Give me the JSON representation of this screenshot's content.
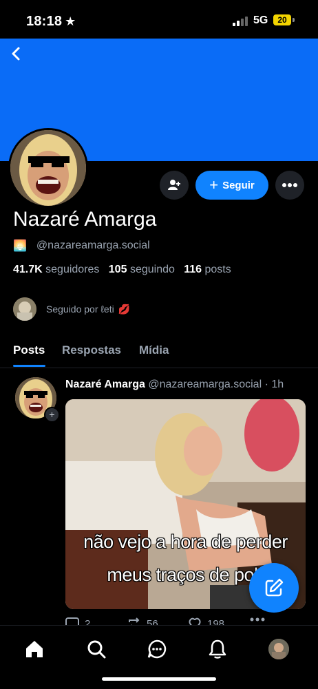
{
  "status_bar": {
    "time": "18:18",
    "star": "★",
    "network": "5G",
    "battery": "20"
  },
  "profile": {
    "name": "Nazaré Amarga",
    "handle_emoji": "🌅",
    "handle": "@nazareamarga.social",
    "followers_count": "41.7K",
    "followers_label": "seguidores",
    "following_count": "105",
    "following_label": "seguindo",
    "posts_count": "116",
    "posts_label": "posts",
    "followed_by": "Seguido por ℓeti",
    "followed_by_emoji": "💋",
    "banner_color": "#0a6cf7"
  },
  "actions": {
    "follow_label": "Seguir",
    "follow_icon": "plus-icon",
    "accent": "#1083fe"
  },
  "tabs": [
    {
      "label": "Posts",
      "active": true
    },
    {
      "label": "Respostas",
      "active": false
    },
    {
      "label": "Mídia",
      "active": false
    }
  ],
  "post": {
    "author": "Nazaré Amarga",
    "handle": "@nazareamarga.social",
    "separator": "·",
    "time": "1h",
    "caption_line1": "não vejo a hora de perder",
    "caption_line2": "meus traços de pob",
    "replies": "2",
    "reposts": "56",
    "likes": "198"
  },
  "nav": [
    "home-icon",
    "search-icon",
    "chat-icon",
    "bell-icon",
    "profile-avatar"
  ]
}
